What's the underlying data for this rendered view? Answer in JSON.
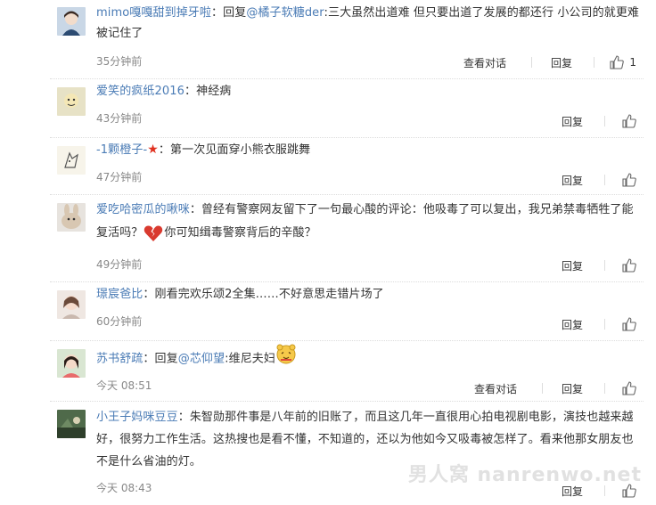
{
  "comments": [
    {
      "user": "mimo嘎嘎甜到掉牙啦",
      "sep": "：",
      "text_pre": "回复",
      "mention": "@橘子软糖der",
      "text": ":三大虽然出道难 但只要出道了发展的都还行 小公司的就更难被记住了",
      "time": "35分钟前",
      "view_conv": "查看对话",
      "reply": "回复",
      "likes": "1"
    },
    {
      "user": "爱笑的疯纸2016",
      "sep": "：",
      "text": "神经病",
      "time": "43分钟前",
      "reply": "回复"
    },
    {
      "user": "-1颗橙子-",
      "sep": "：",
      "text": "第一次见面穿小熊衣服跳舞",
      "time": "47分钟前",
      "reply": "回复"
    },
    {
      "user": "爱吃哈密瓜的啾咪",
      "sep": "：",
      "text": "曾经有警察网友留下了一句最心酸的评论：他吸毒了可以复出，我兄弟禁毒牺牲了能复活吗？",
      "text2": "你可知缉毒警察背后的辛酸？",
      "time": "49分钟前",
      "reply": "回复"
    },
    {
      "user": "璟宸爸比",
      "sep": "：",
      "text": "刚看完欢乐颂2全集……不好意思走错片场了",
      "time": "60分钟前",
      "reply": "回复"
    },
    {
      "user": "苏书舒疏",
      "sep": "：",
      "text_pre": "回复",
      "mention": "@芯仰望",
      "text": ":维尼夫妇",
      "time": "今天 08:51",
      "view_conv": "查看对话",
      "reply": "回复"
    },
    {
      "user": "小王子妈咪豆豆",
      "sep": "：",
      "text": "朱智勋那件事是八年前的旧账了，而且这几年一直很用心拍电视剧电影，演技也越来越好，很努力工作生活。这热搜也是看不懂，不知道的，还以为他如今又吸毒被怎样了。看来他那女朋友也不是什么省油的灯。",
      "time": "今天 08:43",
      "reply": "回复"
    }
  ],
  "watermark": "男人窝 nanrenwo.net",
  "colors": {
    "link": "#4a7bb5",
    "time": "#888888"
  },
  "icons": {
    "like": "thumbs-up-icon",
    "broken_heart": "broken-heart-icon",
    "bear_emoji": "bear-emoji-icon",
    "star_badge": "red-star-icon"
  }
}
